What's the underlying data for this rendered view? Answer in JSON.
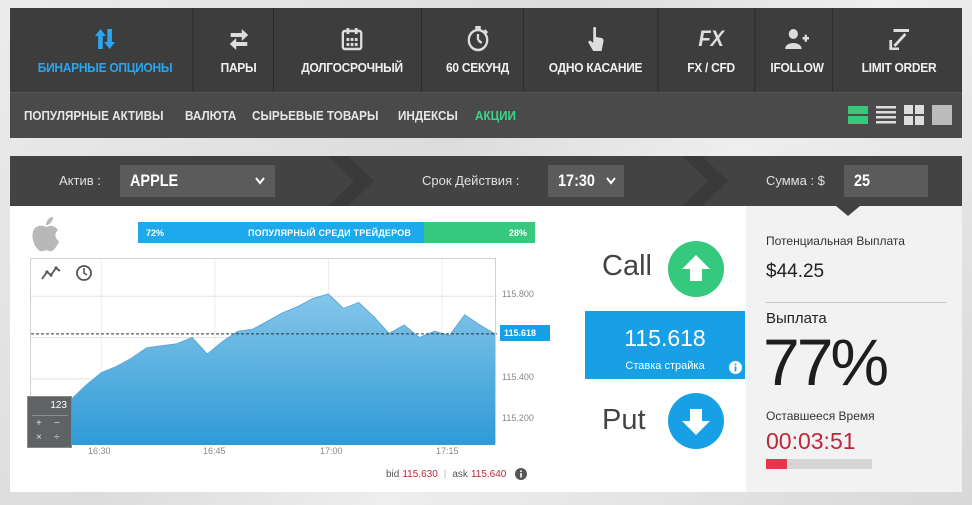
{
  "topnav": [
    {
      "label": "БИНАРНЫЕ ОПЦИОНЫ",
      "icon": "binary-options-icon",
      "active": true
    },
    {
      "label": "ПАРЫ",
      "icon": "pairs-arrows-icon"
    },
    {
      "label": "ДОЛГОСРОЧНЫЙ",
      "icon": "calendar-icon"
    },
    {
      "label": "60 СЕКУНД",
      "icon": "stopwatch-icon"
    },
    {
      "label": "ОДНО КАСАНИЕ",
      "icon": "touch-hand-icon"
    },
    {
      "label": "FX / CFD",
      "icon": "fx-icon",
      "icon_text": "FX"
    },
    {
      "label": "IFOLLOW",
      "icon": "user-add-icon"
    },
    {
      "label": "LIMIT ORDER",
      "icon": "arrow-up-left-icon"
    }
  ],
  "subnav": [
    {
      "label": "ПОПУЛЯРНЫЕ АКТИВЫ"
    },
    {
      "label": "ВАЛЮТА"
    },
    {
      "label": "СЫРЬЕВЫЕ ТОВАРЫ"
    },
    {
      "label": "ИНДЕКСЫ"
    },
    {
      "label": "АКЦИИ",
      "active": true
    }
  ],
  "view_buttons": [
    "view-list-green-icon",
    "view-rows-icon",
    "view-grid-icon",
    "view-single-icon"
  ],
  "options": {
    "asset_label": "Актив :",
    "asset_value": "APPLE",
    "expiry_label": "Срок Действия :",
    "expiry_value": "17:30",
    "amount_label": "Сумма : $",
    "amount_value": "25"
  },
  "popularity": {
    "left_pct": "72%",
    "right_pct": "28%",
    "title": "ПОПУЛЯРНЫЙ СРЕДИ ТРЕЙДЕРОВ",
    "left_share": 0.72
  },
  "chart_data": {
    "type": "area",
    "x": [
      "16:26",
      "16:28",
      "16:30",
      "16:32",
      "16:34",
      "16:36",
      "16:38",
      "16:40",
      "16:42",
      "16:44",
      "16:46",
      "16:48",
      "16:50",
      "16:52",
      "16:54",
      "16:56",
      "16:58",
      "17:00",
      "17:02",
      "17:04",
      "17:06",
      "17:08",
      "17:10",
      "17:12",
      "17:14",
      "17:16",
      "17:18",
      "17:20",
      "17:22"
    ],
    "values": [
      115.3,
      115.37,
      115.43,
      115.46,
      115.5,
      115.55,
      115.56,
      115.57,
      115.6,
      115.52,
      115.58,
      115.63,
      115.64,
      115.68,
      115.72,
      115.75,
      115.79,
      115.81,
      115.74,
      115.77,
      115.7,
      115.62,
      115.66,
      115.6,
      115.63,
      115.61,
      115.71,
      115.66,
      115.618
    ],
    "x_ticks": [
      "16:30",
      "16:45",
      "17:00",
      "17:15"
    ],
    "y_ticks": [
      "115.800",
      "115.600",
      "115.400",
      "115.200"
    ],
    "ylim": [
      115.08,
      115.98
    ],
    "current": "115.618",
    "current_value": 115.618,
    "colors": {
      "fill": "#8fcdee",
      "line": "#5fa9d6"
    }
  },
  "chart_tools": [
    "chart-type-icon",
    "clock-icon"
  ],
  "calculator": {
    "display": "123",
    "keys": [
      "+",
      "−",
      "×",
      "÷"
    ]
  },
  "bid_ask": {
    "bid_label": "bid",
    "bid_value": "115.630",
    "ask_label": "ask",
    "ask_value": "115.640"
  },
  "trade": {
    "call_label": "Call",
    "put_label": "Put",
    "strike_value": "115.618",
    "strike_label": "Ставка страйка"
  },
  "right_panel": {
    "potential_label": "Потенциальная Выплата",
    "potential_value": "$44.25",
    "payout_label": "Выплата",
    "payout_value": "77%",
    "time_label": "Оставшееся Время",
    "time_value": "00:03:51",
    "time_progress": 0.2
  },
  "colors": {
    "accent_blue": "#17a0e6",
    "accent_green": "#35c97e",
    "nav_dark": "#3d3d3d",
    "time_red": "#c0253a"
  }
}
